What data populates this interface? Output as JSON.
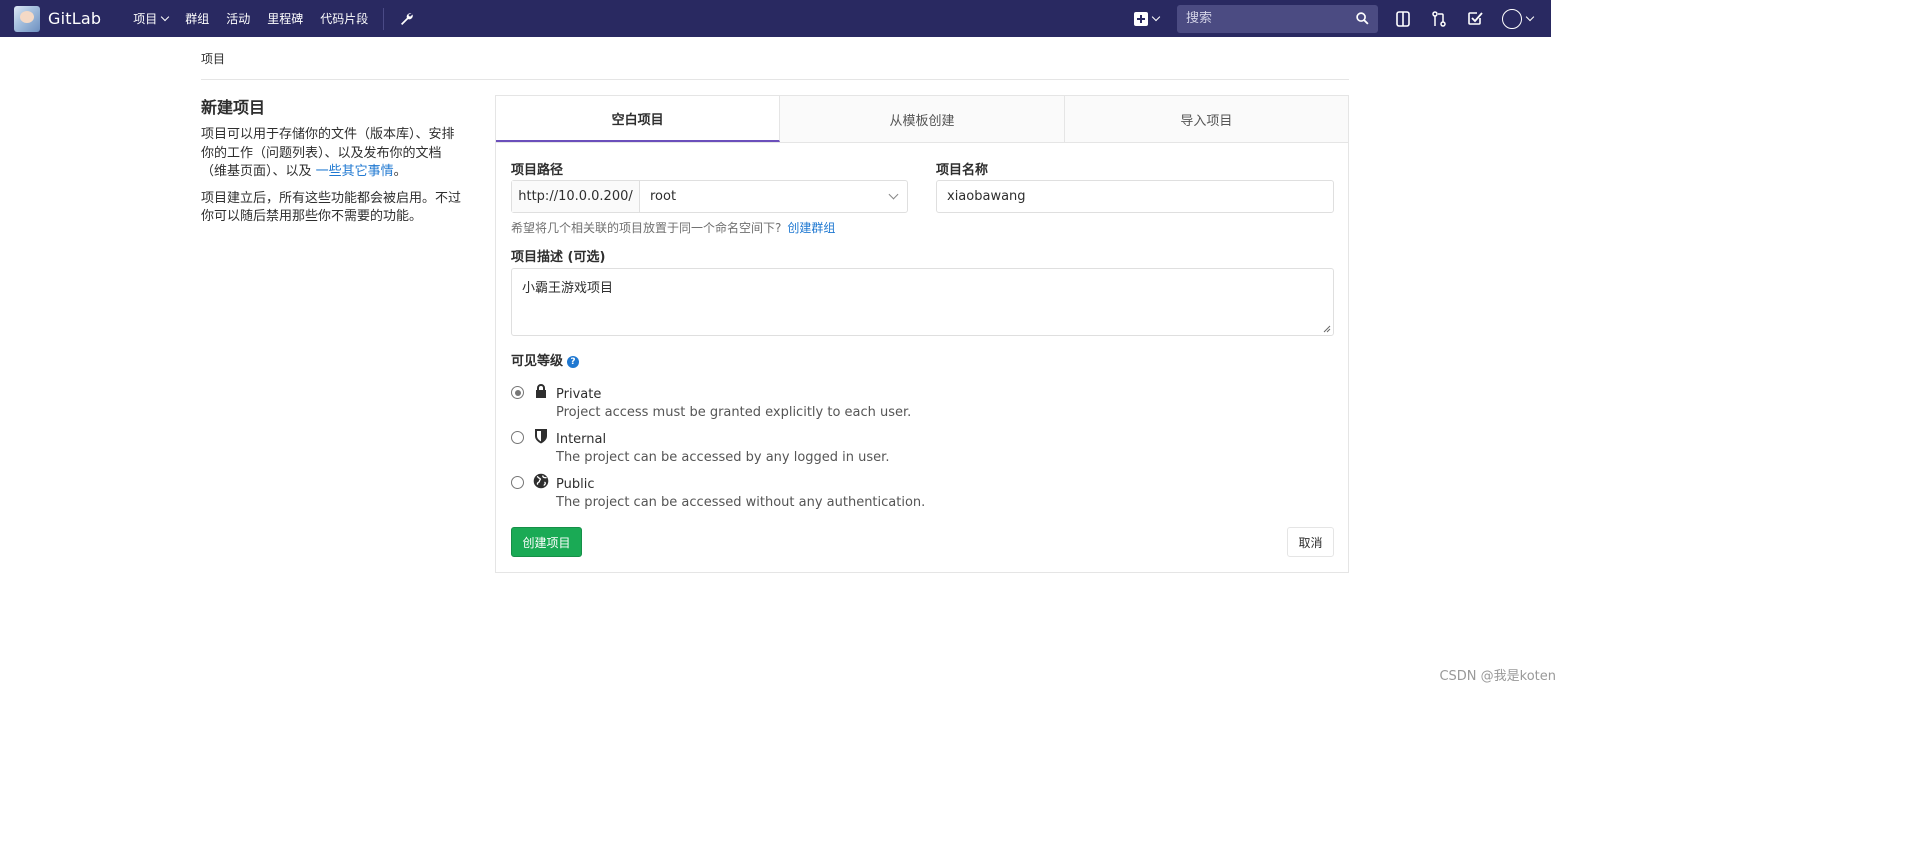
{
  "navbar": {
    "brand": "GitLab",
    "items": [
      "项目",
      "群组",
      "活动",
      "里程碑",
      "代码片段"
    ],
    "search_placeholder": "搜索"
  },
  "breadcrumb": "项目",
  "sidebar": {
    "title": "新建项目",
    "desc1": "项目可以用于存储你的文件（版本库）、安排你的工作（问题列表）、以及发布你的文档（维基页面）、以及 ",
    "desc1_link": "一些其它事情",
    "desc1_end": "。",
    "desc2": "项目建立后，所有这些功能都会被启用。不过你可以随后禁用那些你不需要的功能。"
  },
  "tabs": [
    "空白项目",
    "从模板创建",
    "导入项目"
  ],
  "form": {
    "path_label": "项目路径",
    "path_prefix": "http://10.0.0.200/",
    "namespace": "root",
    "name_label": "项目名称",
    "name_value": "xiaobawang",
    "help_text": "希望将几个相关联的项目放置于同一个命名空间下?",
    "help_link": "创建群组",
    "desc_label": "项目描述 (可选)",
    "desc_value": "小霸王游戏项目",
    "visibility_label": "可见等级",
    "help_icon": "?",
    "visibility": [
      {
        "title": "Private",
        "desc": "Project access must be granted explicitly to each user.",
        "icon": "lock-icon",
        "checked": true
      },
      {
        "title": "Internal",
        "desc": "The project can be accessed by any logged in user.",
        "icon": "shield-icon",
        "checked": false
      },
      {
        "title": "Public",
        "desc": "The project can be accessed without any authentication.",
        "icon": "globe-icon",
        "checked": false
      }
    ],
    "create_label": "创建项目",
    "cancel_label": "取消"
  },
  "watermark": "CSDN @我是koten",
  "colors": {
    "navbar": "#292961",
    "create": "#1aaa55",
    "link": "#1f78d1",
    "active_tab": "#6b4fbb"
  }
}
